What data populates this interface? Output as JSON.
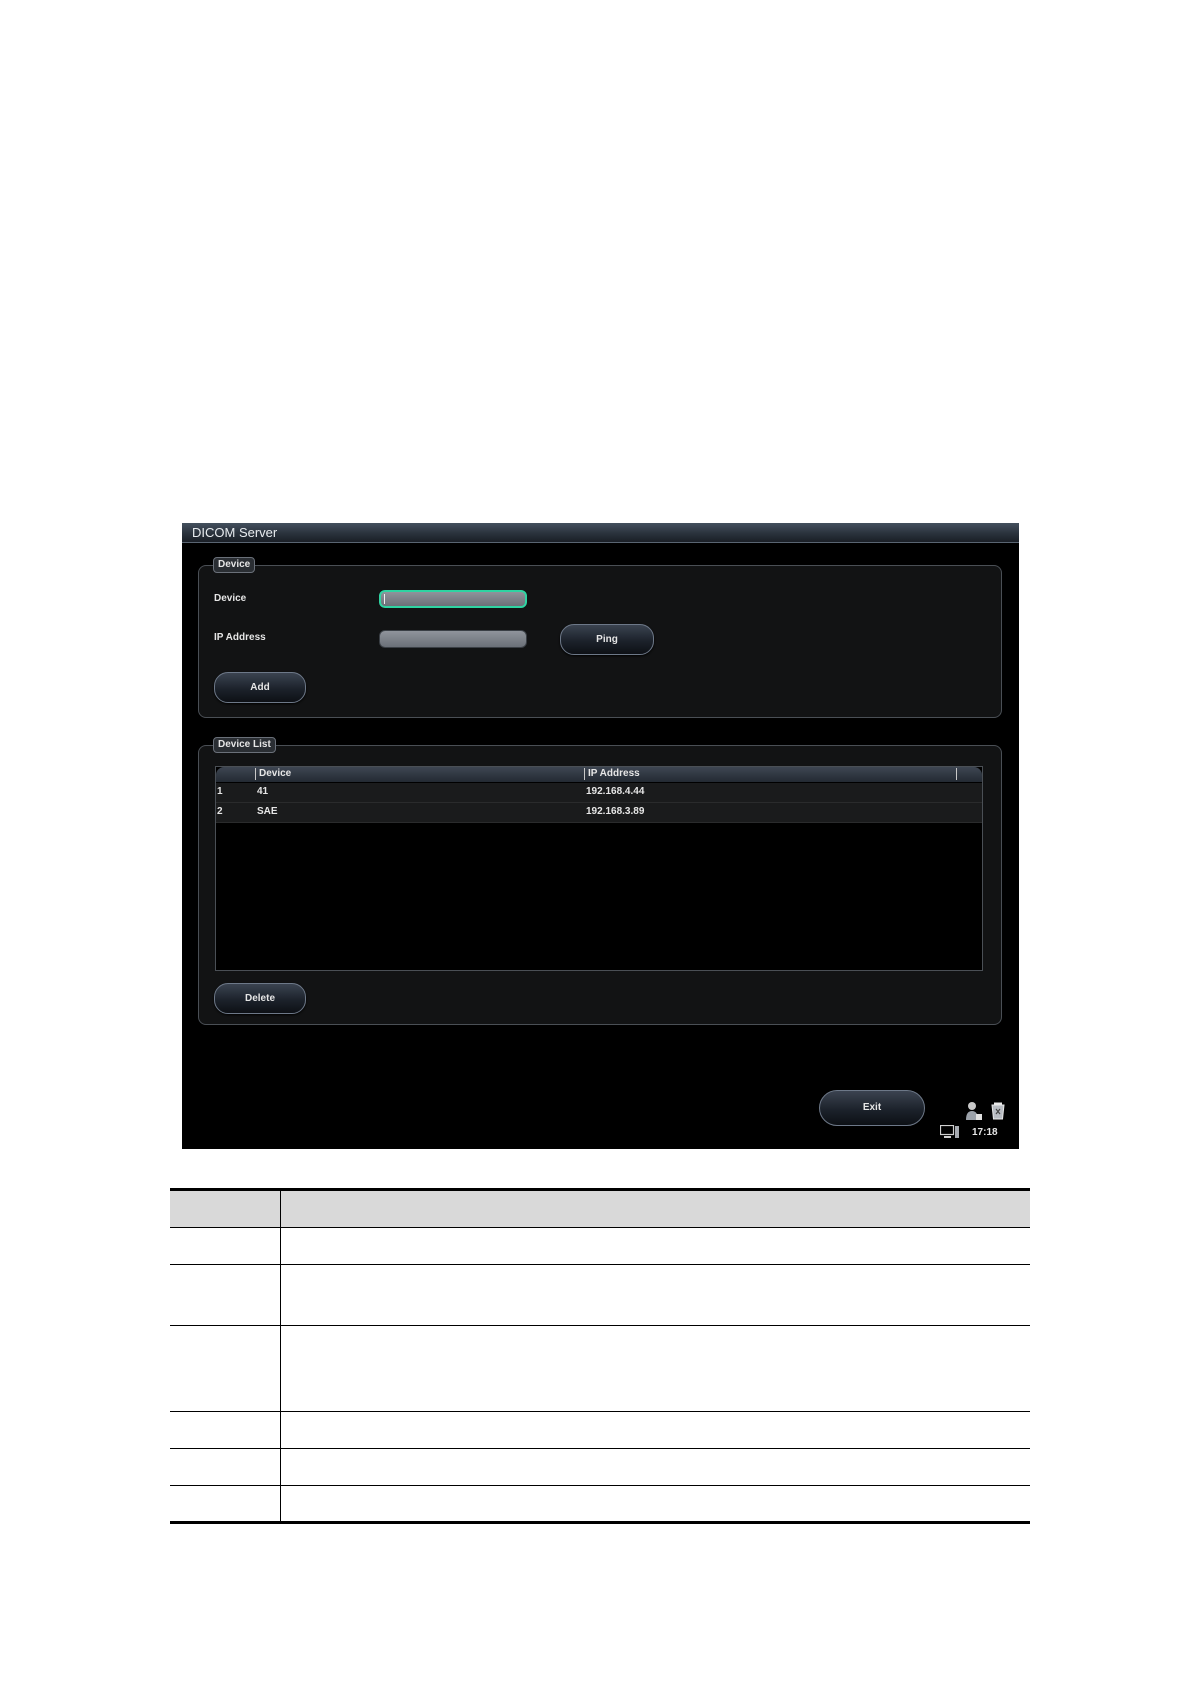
{
  "window": {
    "title": "DICOM Server"
  },
  "device_group": {
    "legend": "Device",
    "device_label": "Device",
    "ip_label": "IP Address",
    "device_value": "",
    "ip_value": "",
    "ping_button": "Ping",
    "add_button": "Add"
  },
  "list_group": {
    "legend": "Device List",
    "columns": [
      "",
      "Device",
      "IP Address"
    ],
    "rows": [
      {
        "index": "1",
        "device": "41",
        "ip": "192.168.4.44"
      },
      {
        "index": "2",
        "device": "SAE",
        "ip": "192.168.3.89"
      }
    ],
    "delete_button": "Delete"
  },
  "footer": {
    "exit_button": "Exit",
    "time": "17:18",
    "icons": [
      "user-icon",
      "recycle-bin-icon",
      "monitor-icon"
    ]
  },
  "param_table": {
    "header": [
      "",
      ""
    ],
    "rows": [
      [
        "",
        ""
      ],
      [
        "",
        ""
      ],
      [
        "",
        ""
      ],
      [
        "",
        ""
      ],
      [
        "",
        ""
      ],
      [
        "",
        ""
      ]
    ]
  },
  "colors": {
    "window_bg": "#000000",
    "active_field_border": "#2fd4a2",
    "header_fill": "#d9d9d9"
  }
}
